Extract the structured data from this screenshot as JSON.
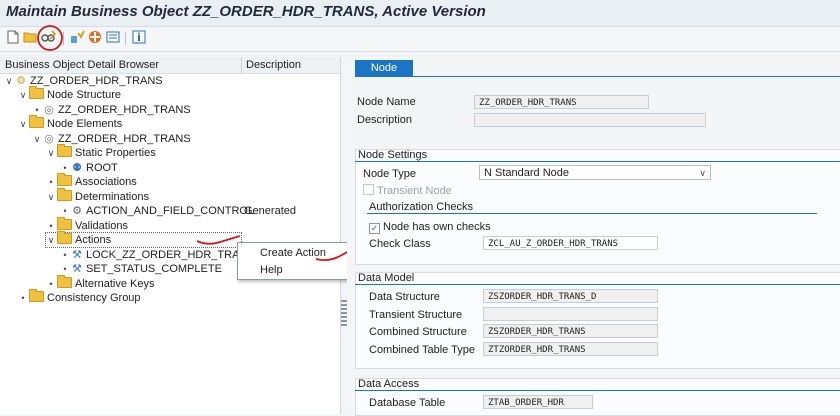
{
  "window": {
    "title": "Maintain Business Object ZZ_ORDER_HDR_TRANS, Active Version"
  },
  "toolbar": {
    "icons": [
      "new-document-icon",
      "open-folder-icon",
      "display-change-icon",
      "check-icon",
      "activate-icon",
      "where-used-icon",
      "info-icon"
    ]
  },
  "tree": {
    "columns": {
      "browser": "Business Object Detail Browser",
      "description": "Description"
    },
    "nodes": {
      "root": "ZZ_ORDER_HDR_TRANS",
      "node_structure": "Node Structure",
      "node_structure_child": "ZZ_ORDER_HDR_TRANS",
      "node_elements": "Node Elements",
      "node_elements_child": "ZZ_ORDER_HDR_TRANS",
      "static_properties": "Static Properties",
      "root_node": "ROOT",
      "associations": "Associations",
      "determinations": "Determinations",
      "action_field_control": "ACTION_AND_FIELD_CONTROL",
      "action_field_control_desc": "Generated",
      "validations": "Validations",
      "actions": "Actions",
      "lock_action": "LOCK_ZZ_ORDER_HDR_TRANS",
      "set_status": "SET_STATUS_COMPLETE",
      "alternative_keys": "Alternative Keys",
      "consistency_group": "Consistency Group"
    }
  },
  "context_menu": {
    "create_action": "Create Action",
    "help": "Help"
  },
  "detail": {
    "tab": "Node",
    "node_name_label": "Node Name",
    "node_name_value": "ZZ_ORDER_HDR_TRANS",
    "description_label": "Description",
    "description_value": "",
    "node_settings": {
      "title": "Node Settings",
      "node_type_label": "Node Type",
      "node_type_value": "N Standard Node",
      "transient_node_label": "Transient Node",
      "transient_node_checked": false,
      "auth_checks_title": "Authorization Checks",
      "own_checks_label": "Node has own checks",
      "own_checks_checked": true,
      "check_class_label": "Check Class",
      "check_class_value": "ZCL_AU_Z_ORDER_HDR_TRANS"
    },
    "data_model": {
      "title": "Data Model",
      "data_structure_label": "Data Structure",
      "data_structure_value": "ZSZORDER_HDR_TRANS_D",
      "transient_structure_label": "Transient Structure",
      "transient_structure_value": "",
      "combined_structure_label": "Combined Structure",
      "combined_structure_value": "ZSZORDER_HDR_TRANS",
      "combined_table_type_label": "Combined Table Type",
      "combined_table_type_value": "ZTZORDER_HDR_TRANS"
    },
    "data_access": {
      "title": "Data Access",
      "database_table_label": "Database Table",
      "database_table_value": "ZTAB_ORDER_HDR"
    }
  },
  "colors": {
    "accent": "#1b74c6",
    "annotation": "#d4161c",
    "folder": "#f0c040"
  }
}
